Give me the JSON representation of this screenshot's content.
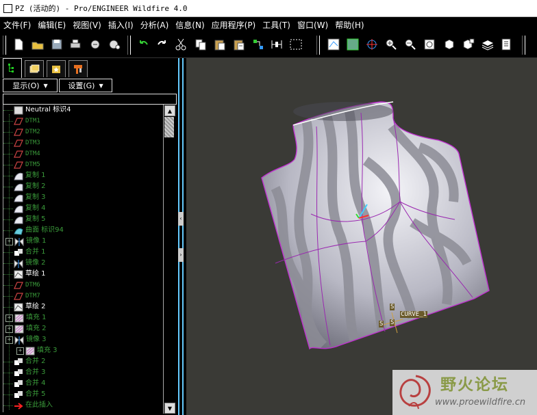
{
  "window": {
    "title": "PZ (活动的) - Pro/ENGINEER Wildfire 4.0"
  },
  "menu": [
    "文件(F)",
    "编辑(E)",
    "视图(V)",
    "插入(I)",
    "分析(A)",
    "信息(N)",
    "应用程序(P)",
    "工具(T)",
    "窗口(W)",
    "帮助(H)"
  ],
  "toolbar": {
    "icons": [
      "new-file",
      "open-folder",
      "save",
      "print",
      "email",
      "email-link",
      "undo",
      "redo",
      "cut",
      "copy",
      "paste",
      "paste-special",
      "regenerate",
      "edit-dimensions",
      "select-box",
      "repaint",
      "shading",
      "spin-center",
      "zoom-in",
      "zoom-out",
      "refit",
      "orient",
      "saved-views",
      "layers",
      "model-tree"
    ]
  },
  "panel": {
    "show_label": "显示(O)",
    "settings_label": "设置(G)",
    "tree": [
      {
        "label": "Neutral 标识4",
        "kind": "part",
        "color": "#ffffff",
        "indent": 1,
        "exp": false
      },
      {
        "label": "DTM1",
        "kind": "datum",
        "color": "#3a9a3a",
        "indent": 1,
        "exp": false
      },
      {
        "label": "DTM2",
        "kind": "datum",
        "color": "#3a9a3a",
        "indent": 1,
        "exp": false
      },
      {
        "label": "DTM3",
        "kind": "datum",
        "color": "#3a9a3a",
        "indent": 1,
        "exp": false
      },
      {
        "label": "DTM4",
        "kind": "datum",
        "color": "#3a9a3a",
        "indent": 1,
        "exp": false
      },
      {
        "label": "DTM5",
        "kind": "datum",
        "color": "#3a9a3a",
        "indent": 1,
        "exp": false
      },
      {
        "label": "复制 1",
        "kind": "copy",
        "color": "#3a9a3a",
        "indent": 1,
        "exp": false
      },
      {
        "label": "复制 2",
        "kind": "copy",
        "color": "#3a9a3a",
        "indent": 1,
        "exp": false
      },
      {
        "label": "复制 3",
        "kind": "copy",
        "color": "#3a9a3a",
        "indent": 1,
        "exp": false
      },
      {
        "label": "复制 4",
        "kind": "copy",
        "color": "#3a9a3a",
        "indent": 1,
        "exp": false
      },
      {
        "label": "复制 5",
        "kind": "copy",
        "color": "#3a9a3a",
        "indent": 1,
        "exp": false
      },
      {
        "label": "曲面 标识94",
        "kind": "surface",
        "color": "#3a9a3a",
        "indent": 1,
        "exp": false
      },
      {
        "label": "镜像 1",
        "kind": "mirror",
        "color": "#3a9a3a",
        "indent": 1,
        "exp": true
      },
      {
        "label": "合并 1",
        "kind": "merge",
        "color": "#3a9a3a",
        "indent": 1,
        "exp": false
      },
      {
        "label": "镜像 2",
        "kind": "mirror",
        "color": "#3a9a3a",
        "indent": 1,
        "exp": false
      },
      {
        "label": "草绘 1",
        "kind": "sketch",
        "color": "#ffffff",
        "indent": 1,
        "exp": false
      },
      {
        "label": "DTM6",
        "kind": "datum",
        "color": "#3a9a3a",
        "indent": 1,
        "exp": false
      },
      {
        "label": "DTM7",
        "kind": "datum",
        "color": "#3a9a3a",
        "indent": 1,
        "exp": false
      },
      {
        "label": "草绘 2",
        "kind": "sketch",
        "color": "#ffffff",
        "indent": 1,
        "exp": false
      },
      {
        "label": "填充 1",
        "kind": "fill",
        "color": "#3a9a3a",
        "indent": 1,
        "exp": true
      },
      {
        "label": "填充 2",
        "kind": "fill",
        "color": "#3a9a3a",
        "indent": 1,
        "exp": true
      },
      {
        "label": "镜像 3",
        "kind": "mirror",
        "color": "#3a9a3a",
        "indent": 1,
        "exp": true
      },
      {
        "label": "填充 3",
        "kind": "fill",
        "color": "#3a9a3a",
        "indent": 2,
        "exp": true
      },
      {
        "label": "合并 2",
        "kind": "merge",
        "color": "#3a9a3a",
        "indent": 1,
        "exp": false
      },
      {
        "label": "合并 3",
        "kind": "merge",
        "color": "#3a9a3a",
        "indent": 1,
        "exp": false
      },
      {
        "label": "合并 4",
        "kind": "merge",
        "color": "#3a9a3a",
        "indent": 1,
        "exp": false
      },
      {
        "label": "合并 5",
        "kind": "merge",
        "color": "#3a9a3a",
        "indent": 1,
        "exp": false
      },
      {
        "label": "在此插入",
        "kind": "insert",
        "color": "#3a9a3a",
        "indent": 1,
        "exp": false
      }
    ]
  },
  "viewport": {
    "background": "#3a3a36",
    "curve_label": "CURVE_1",
    "csys_labels": [
      "S",
      "S",
      "S"
    ]
  },
  "watermark": {
    "title": "野火论坛",
    "url": "www.proewildfire.cn"
  }
}
